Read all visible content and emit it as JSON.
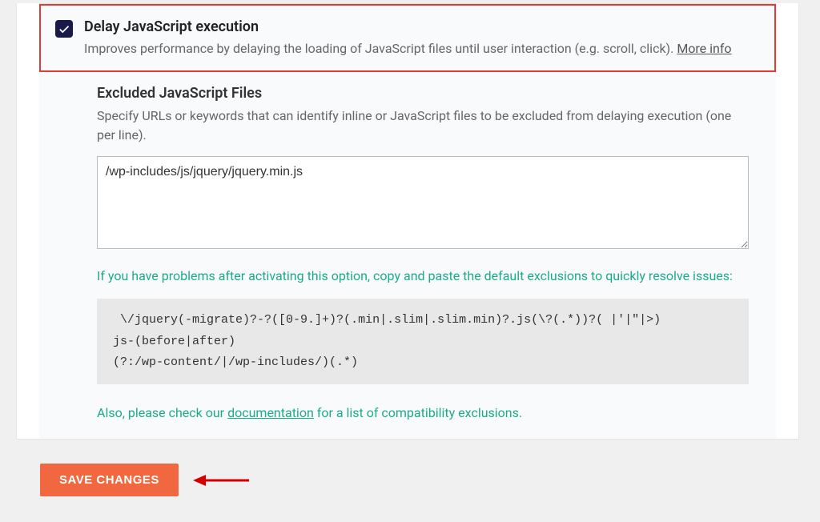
{
  "option": {
    "title": "Delay JavaScript execution",
    "desc": "Improves performance by delaying the loading of JavaScript files until user interaction (e.g. scroll, click). ",
    "more_info": "More info"
  },
  "excluded": {
    "title": "Excluded JavaScript Files",
    "desc": "Specify URLs or keywords that can identify inline or JavaScript files to be excluded from delaying execution (one per line).",
    "value": "/wp-includes/js/jquery/jquery.min.js"
  },
  "help1": "If you have problems after activating this option, copy and paste the default exclusions to quickly resolve issues:",
  "code": " \\/jquery(-migrate)?-?([0-9.]+)?(.min|.slim|.slim.min)?.js(\\?(.*))?( |'|\"|>)\njs-(before|after)\n(?:/wp-content/|/wp-includes/)(.*)",
  "help2_pre": "Also, please check our ",
  "help2_link": "documentation",
  "help2_post": " for a list of compatibility exclusions.",
  "save_label": "SAVE CHANGES"
}
